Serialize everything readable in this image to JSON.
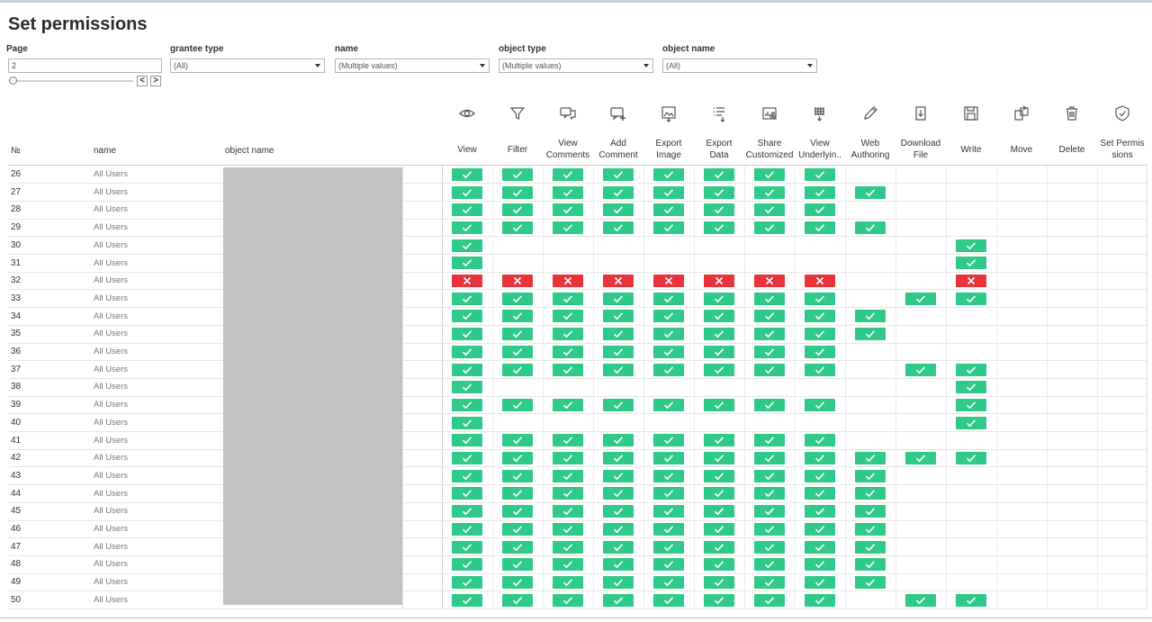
{
  "title": "Set permissions",
  "filters": {
    "page": {
      "label": "Page",
      "value": "2"
    },
    "grantee_type": {
      "label": "grantee type",
      "value": "(All)"
    },
    "name": {
      "label": "name",
      "value": "(Multiple values)"
    },
    "object_type": {
      "label": "object type",
      "value": "(Multiple values)"
    },
    "object_name": {
      "label": "object name",
      "value": "(All)"
    }
  },
  "nav": {
    "prev": "<",
    "next": ">"
  },
  "columns": {
    "num": "№",
    "name": "name",
    "object_name": "object name"
  },
  "permissions": [
    {
      "key": "view",
      "label": [
        "View"
      ],
      "icon": "eye-icon"
    },
    {
      "key": "filter",
      "label": [
        "Filter"
      ],
      "icon": "funnel-icon"
    },
    {
      "key": "view_comments",
      "label": [
        "View",
        "Comments"
      ],
      "icon": "comments-icon"
    },
    {
      "key": "add_comment",
      "label": [
        "Add",
        "Comment"
      ],
      "icon": "add-comment-icon"
    },
    {
      "key": "export_image",
      "label": [
        "Export",
        "Image"
      ],
      "icon": "export-image-icon"
    },
    {
      "key": "export_data",
      "label": [
        "Export",
        "Data"
      ],
      "icon": "export-data-icon"
    },
    {
      "key": "share_customized",
      "label": [
        "Share",
        "Customized"
      ],
      "icon": "share-customized-icon"
    },
    {
      "key": "view_underlying",
      "label": [
        "View",
        "Underlyin.."
      ],
      "icon": "view-underlying-icon"
    },
    {
      "key": "web_authoring",
      "label": [
        "Web",
        "Authoring"
      ],
      "icon": "pencil-icon"
    },
    {
      "key": "download_file",
      "label": [
        "Download",
        "File"
      ],
      "icon": "download-file-icon"
    },
    {
      "key": "write",
      "label": [
        "Write"
      ],
      "icon": "save-icon"
    },
    {
      "key": "move",
      "label": [
        "Move"
      ],
      "icon": "move-icon"
    },
    {
      "key": "delete",
      "label": [
        "Delete"
      ],
      "icon": "trash-icon"
    },
    {
      "key": "set_permissions",
      "label": [
        "Set Permis",
        "sions"
      ],
      "icon": "shield-check-icon"
    }
  ],
  "rows": [
    {
      "num": "26",
      "name": "All Users",
      "cells": "11111111"
    },
    {
      "num": "27",
      "name": "All Users",
      "cells": "111111111"
    },
    {
      "num": "28",
      "name": "All Users",
      "cells": "11111111"
    },
    {
      "num": "29",
      "name": "All Users",
      "cells": "111111111"
    },
    {
      "num": "30",
      "name": "All Users",
      "cells": "1000000000100"
    },
    {
      "num": "31",
      "name": "All Users",
      "cells": "1000000000100"
    },
    {
      "num": "32",
      "name": "All Users",
      "cells": "xxxxxxxx00x"
    },
    {
      "num": "33",
      "name": "All Users",
      "cells": "11111111011"
    },
    {
      "num": "34",
      "name": "All Users",
      "cells": "111111111"
    },
    {
      "num": "35",
      "name": "All Users",
      "cells": "111111111"
    },
    {
      "num": "36",
      "name": "All Users",
      "cells": "11111111"
    },
    {
      "num": "37",
      "name": "All Users",
      "cells": "11111111011"
    },
    {
      "num": "38",
      "name": "All Users",
      "cells": "1000000000100"
    },
    {
      "num": "39",
      "name": "All Users",
      "cells": "11111111001"
    },
    {
      "num": "40",
      "name": "All Users",
      "cells": "1000000000100"
    },
    {
      "num": "41",
      "name": "All Users",
      "cells": "11111111"
    },
    {
      "num": "42",
      "name": "All Users",
      "cells": "11111111111"
    },
    {
      "num": "43",
      "name": "All Users",
      "cells": "111111111"
    },
    {
      "num": "44",
      "name": "All Users",
      "cells": "111111111"
    },
    {
      "num": "45",
      "name": "All Users",
      "cells": "111111111"
    },
    {
      "num": "46",
      "name": "All Users",
      "cells": "111111111"
    },
    {
      "num": "47",
      "name": "All Users",
      "cells": "111111111"
    },
    {
      "num": "48",
      "name": "All Users",
      "cells": "111111111"
    },
    {
      "num": "49",
      "name": "All Users",
      "cells": "111111111"
    },
    {
      "num": "50",
      "name": "All Users",
      "cells": "11111111011"
    }
  ],
  "colors": {
    "allow": "#2fc989",
    "deny": "#e8333b",
    "redacted": "#c2c2c2"
  }
}
